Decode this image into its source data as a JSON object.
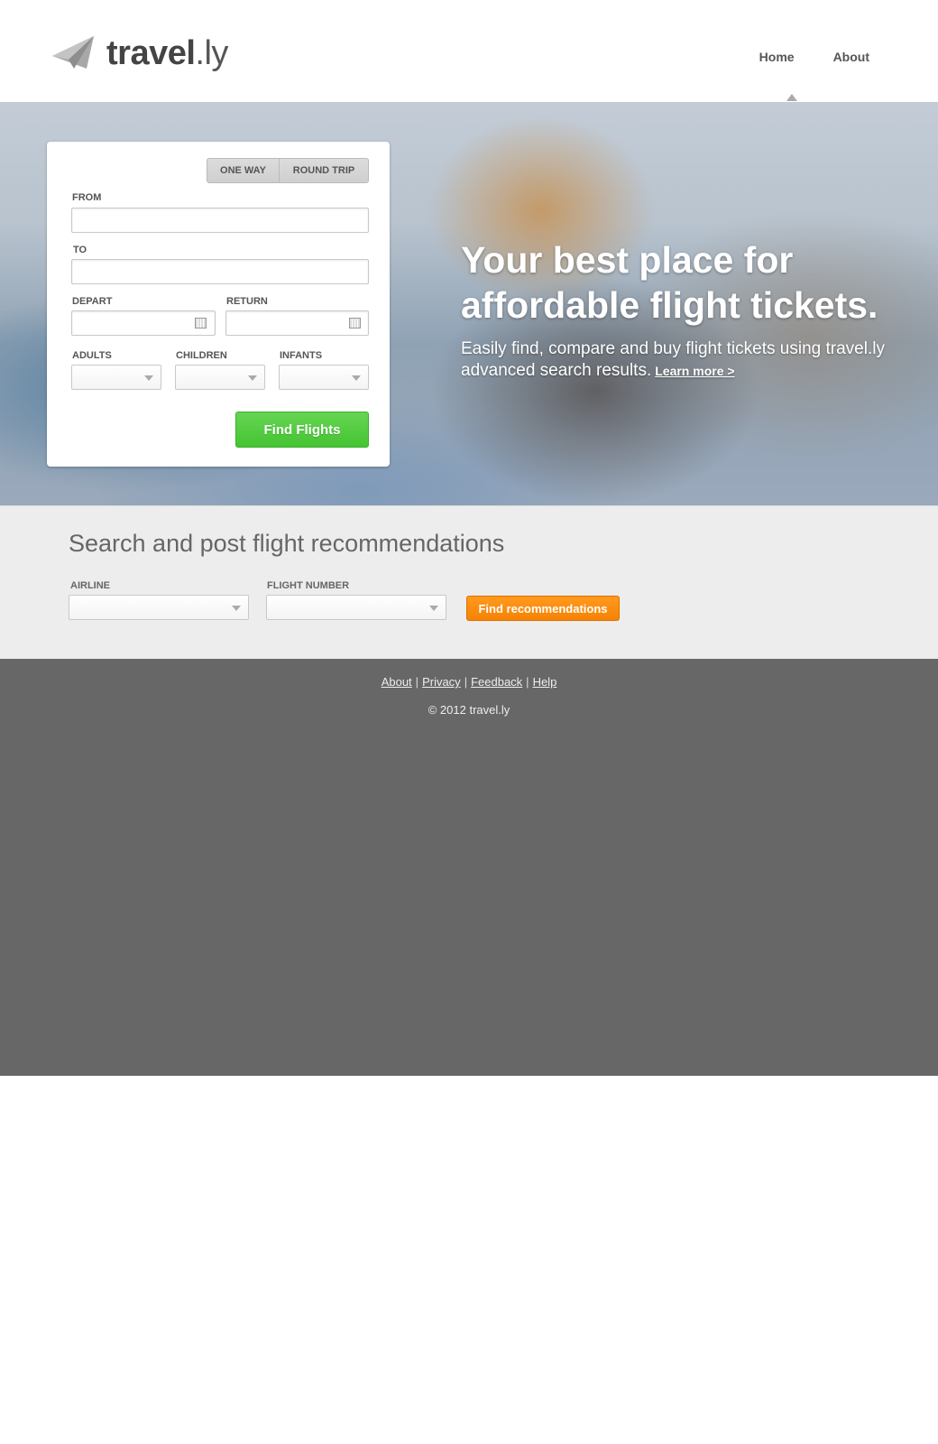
{
  "brand": {
    "name_bold": "travel",
    "name_light": ".ly"
  },
  "nav": {
    "items": [
      {
        "label": "Home",
        "active": true
      },
      {
        "label": "About",
        "active": false
      }
    ]
  },
  "search": {
    "trip_types": [
      "ONE WAY",
      "ROUND TRIP"
    ],
    "from_label": "FROM",
    "from_value": "",
    "to_label": "TO",
    "to_value": "",
    "depart_label": "DEPART",
    "depart_value": "",
    "return_label": "RETURN",
    "return_value": "",
    "adults_label": "ADULTS",
    "children_label": "CHILDREN",
    "infants_label": "INFANTS",
    "submit_label": "Find Flights",
    "submit_color": "#4ccb39"
  },
  "hero": {
    "title": "Your best place for affordable flight tickets.",
    "subtitle": "Easily find, compare and buy flight tickets using travel.ly advanced search results.",
    "learn_more": "Learn more >"
  },
  "recommendations": {
    "title": "Search and post flight recommendations",
    "airline_label": "AIRLINE",
    "flight_number_label": "FLIGHT NUMBER",
    "submit_label": "Find recommendations",
    "submit_color": "#f7880b"
  },
  "footer": {
    "links": [
      "About",
      "Privacy",
      "Feedback",
      "Help"
    ],
    "separator": "|",
    "copyright": "© 2012 travel.ly",
    "background": "#676767"
  }
}
